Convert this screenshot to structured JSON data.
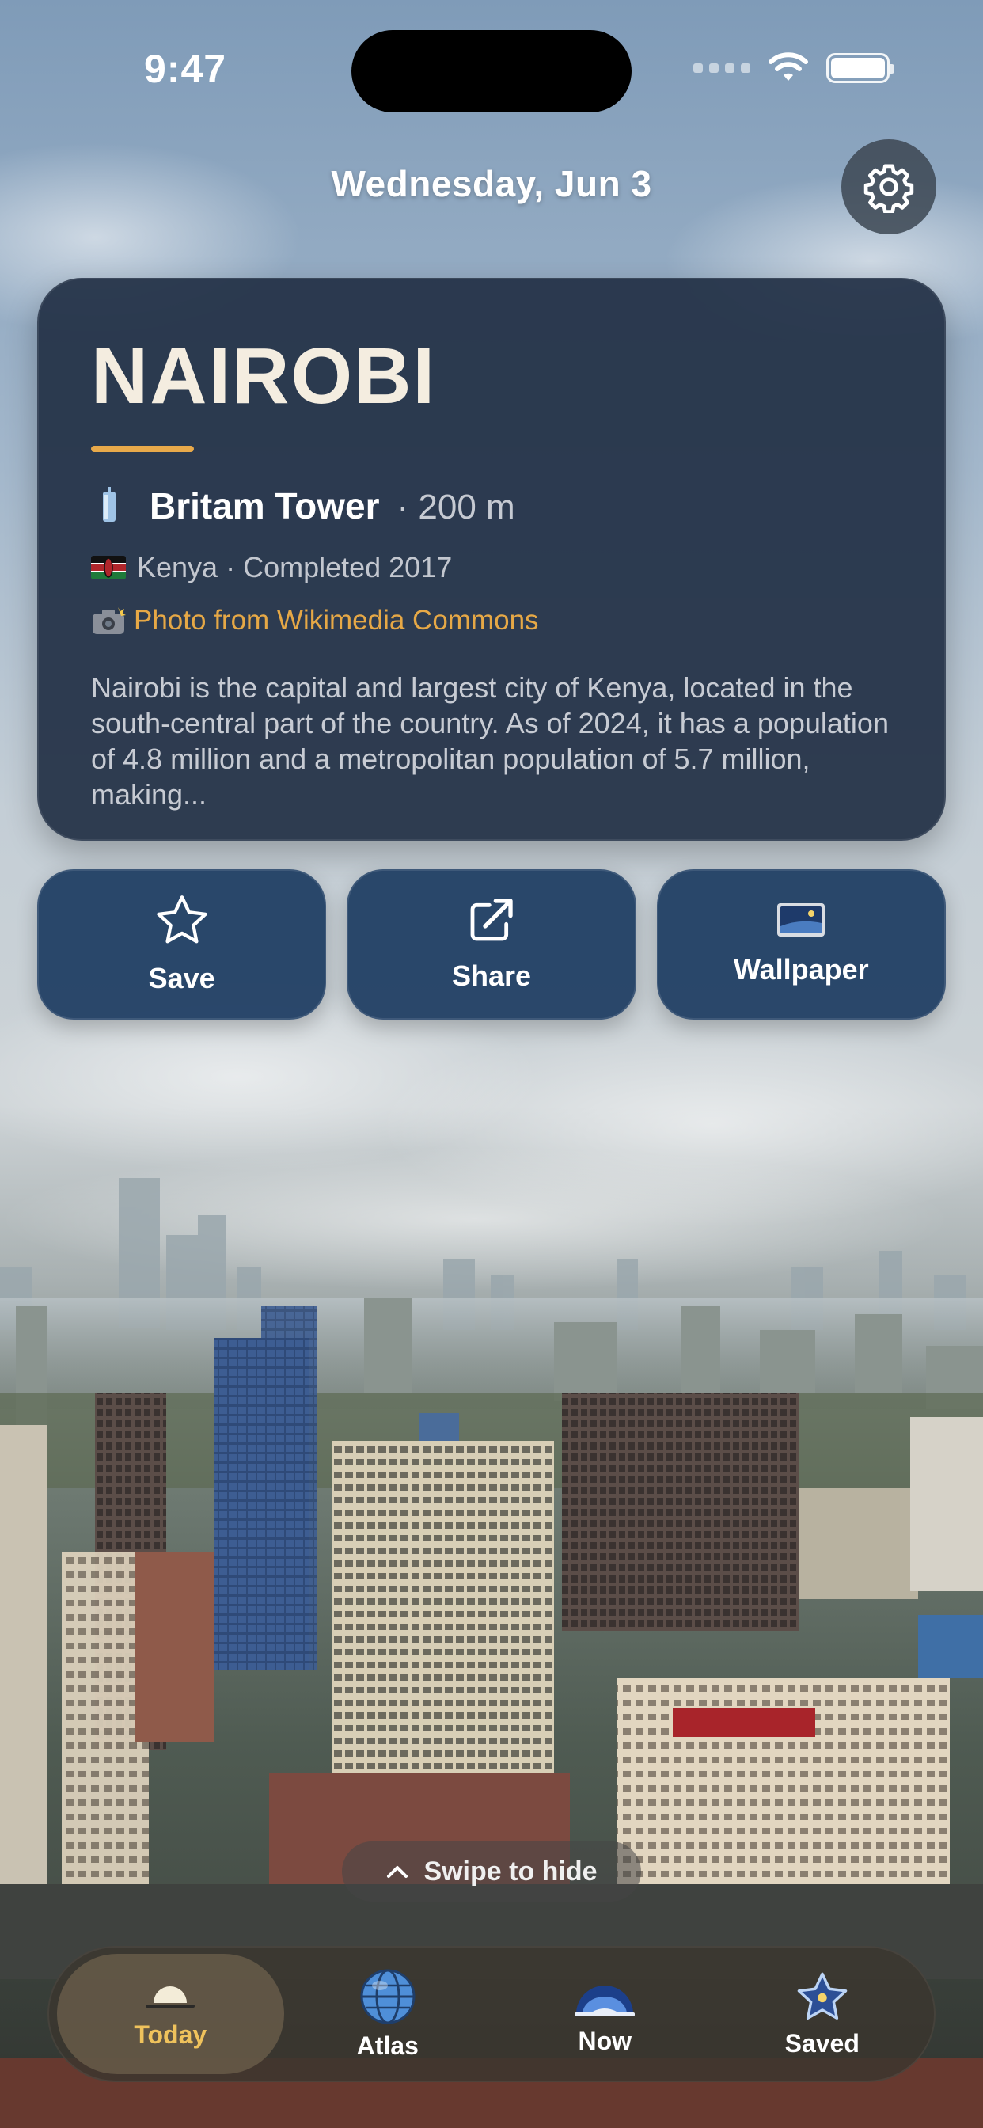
{
  "status_bar": {
    "time": "9:47"
  },
  "header": {
    "date": "Wednesday, Jun 3"
  },
  "card": {
    "city": "NAIROBI",
    "tower_name": "Britam Tower",
    "tower_height": "· 200 m",
    "meta": "Kenya · Completed 2017",
    "credit": "Photo from Wikimedia Commons",
    "description": "Nairobi is the capital and largest city of Kenya, located in the south-central part of the country. As of 2024, it has a population of 4.8 million and a metropolitan population of 5.7 million, making..."
  },
  "actions": {
    "save": "Save",
    "share": "Share",
    "wallpaper": "Wallpaper"
  },
  "swipe_hint": "Swipe to hide",
  "tabs": [
    {
      "label": "Today",
      "icon": "sunrise-icon",
      "active": true
    },
    {
      "label": "Atlas",
      "icon": "globe-icon"
    },
    {
      "label": "Now",
      "icon": "horizon-icon"
    },
    {
      "label": "Saved",
      "icon": "star-icon"
    }
  ],
  "colors": {
    "accent": "#e8a94a",
    "active_tab": "#efc25c",
    "card_bg": "#223046",
    "button_bg": "#213f64"
  }
}
